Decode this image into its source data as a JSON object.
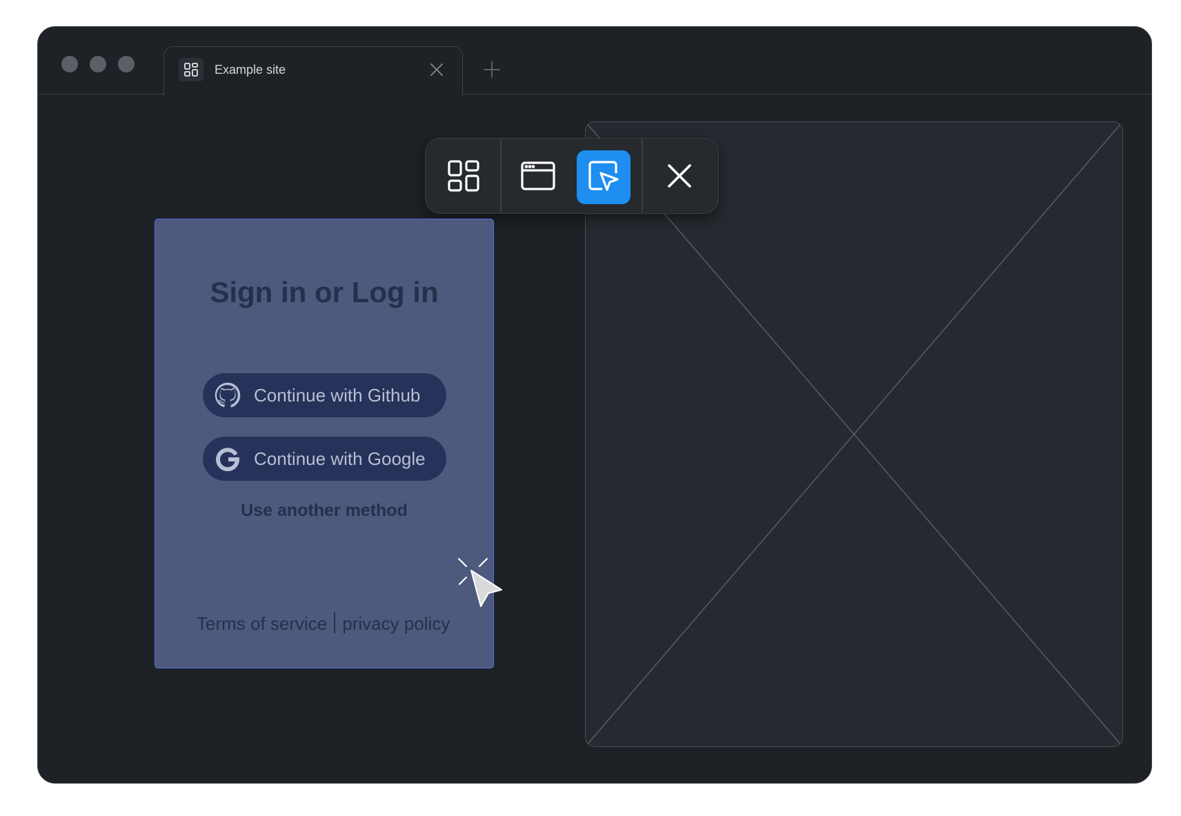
{
  "browser": {
    "tab": {
      "title": "Example site",
      "favicon": "grid-icon",
      "close_icon": "close-icon"
    },
    "new_tab_icon": "plus-icon"
  },
  "toolbar": {
    "buttons": [
      {
        "icon": "grid-icon",
        "active": false
      },
      {
        "icon": "browser-window-icon",
        "active": false
      },
      {
        "icon": "select-element-icon",
        "active": true
      },
      {
        "icon": "close-icon",
        "active": false
      }
    ],
    "accent_color": "#1e8ef0"
  },
  "signin": {
    "title": "Sign in or Log in",
    "github_label": "Continue with Github",
    "google_label": "Continue with Google",
    "another_method": "Use another method",
    "terms": "Terms of service",
    "privacy": "privacy policy",
    "highlight_color": "#5c6ae6"
  },
  "placeholder": {
    "icon": "image-placeholder-icon"
  },
  "cursor": {
    "icon": "click-cursor-icon"
  }
}
